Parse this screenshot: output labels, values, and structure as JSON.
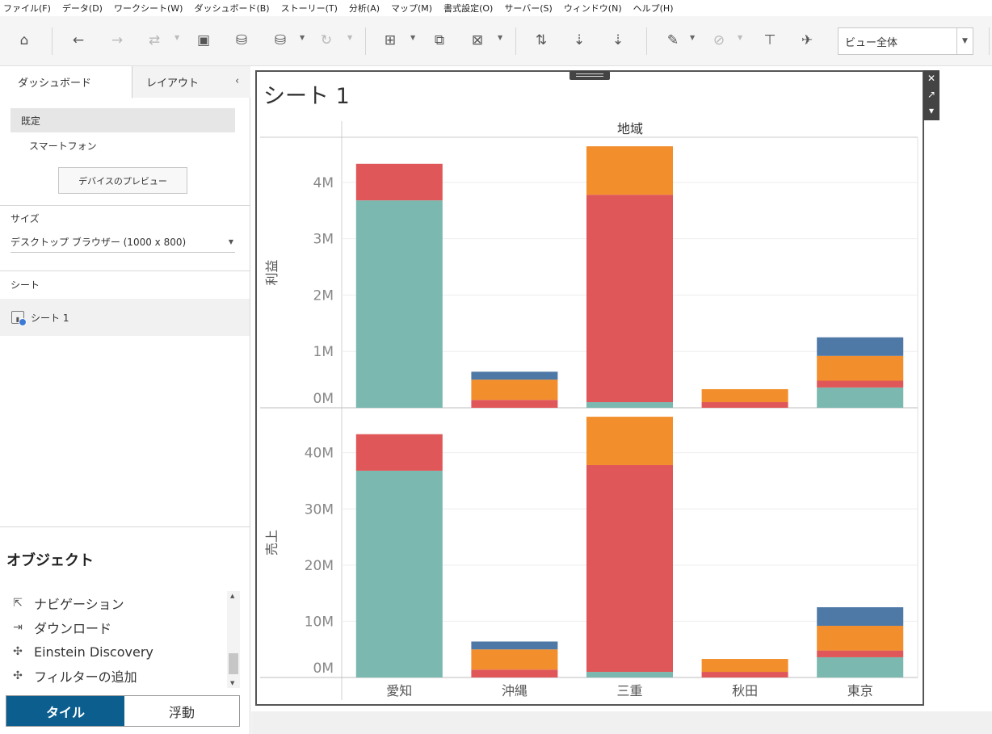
{
  "menu": [
    "ファイル(F)",
    "データ(D)",
    "ワークシート(W)",
    "ダッシュボード(B)",
    "ストーリー(T)",
    "分析(A)",
    "マップ(M)",
    "書式設定(O)",
    "サーバー(S)",
    "ウィンドウ(N)",
    "ヘルプ(H)"
  ],
  "toolbar": {
    "view_select": "ビュー全体"
  },
  "left_panel": {
    "tab_dashboard": "ダッシュボード",
    "tab_layout": "レイアウト",
    "device_default": "既定",
    "device_phone": "スマートフォン",
    "device_preview_button": "デバイスのプレビュー",
    "size_label": "サイズ",
    "size_value": "デスクトップ ブラウザー (1000 x 800)",
    "sheets_label": "シート",
    "sheet_item": "シート 1",
    "objects_title": "オブジェクト",
    "objects": [
      {
        "label": "ナビゲーション",
        "icon": "navigation-icon"
      },
      {
        "label": "ダウンロード",
        "icon": "download-icon"
      },
      {
        "label": "Einstein Discovery",
        "icon": "extension-icon"
      },
      {
        "label": "フィルターの追加",
        "icon": "extension-icon"
      }
    ],
    "tile_button": "タイル",
    "float_button": "浮動"
  },
  "sheet_title": "シート 1",
  "colors": {
    "teal": "#7ab8b0",
    "red": "#e05759",
    "orange": "#f28e2b",
    "blue": "#4e79a7",
    "tile_active": "#0b5e8e"
  },
  "chart_data": {
    "type": "bar",
    "stacked": true,
    "column_header": "地域",
    "categories": [
      "愛知",
      "沖縄",
      "三重",
      "秋田",
      "東京"
    ],
    "panes": [
      {
        "ylabel": "利益",
        "ylim": [
          0,
          4800000
        ],
        "ticks": [
          0,
          1000000,
          2000000,
          3000000,
          4000000
        ],
        "tick_labels": [
          "0M",
          "1M",
          "2M",
          "3M",
          "4M"
        ],
        "series": [
          {
            "color": "#7ab8b0",
            "values": [
              3680000,
              0,
              100000,
              0,
              360000
            ]
          },
          {
            "color": "#e05759",
            "values": [
              650000,
              140000,
              3680000,
              100000,
              120000
            ]
          },
          {
            "color": "#f28e2b",
            "values": [
              0,
              360000,
              860000,
              230000,
              440000
            ]
          },
          {
            "color": "#4e79a7",
            "values": [
              0,
              140000,
              0,
              0,
              330000
            ]
          }
        ]
      },
      {
        "ylabel": "売上",
        "ylim": [
          0,
          48000000
        ],
        "ticks": [
          0,
          10000000,
          20000000,
          30000000,
          40000000
        ],
        "tick_labels": [
          "0M",
          "10M",
          "20M",
          "30M",
          "40M"
        ],
        "series": [
          {
            "color": "#7ab8b0",
            "values": [
              36800000,
              0,
              1000000,
              0,
              3600000
            ]
          },
          {
            "color": "#e05759",
            "values": [
              6500000,
              1400000,
              36800000,
              1000000,
              1200000
            ]
          },
          {
            "color": "#f28e2b",
            "values": [
              0,
              3600000,
              8600000,
              2300000,
              4400000
            ]
          },
          {
            "color": "#4e79a7",
            "values": [
              0,
              1400000,
              0,
              0,
              3300000
            ]
          }
        ]
      }
    ],
    "grid": true
  }
}
